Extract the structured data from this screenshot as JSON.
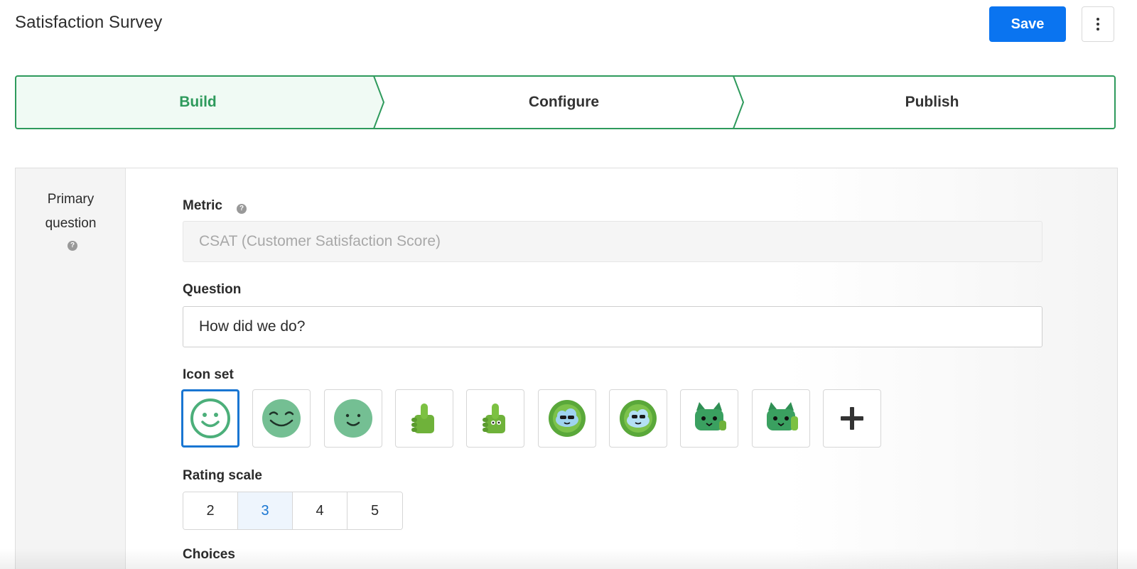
{
  "header": {
    "title": "Satisfaction Survey",
    "save_label": "Save",
    "more_icon": "more-vertical-icon"
  },
  "steps": [
    {
      "label": "Build",
      "active": true
    },
    {
      "label": "Configure",
      "active": false
    },
    {
      "label": "Publish",
      "active": false
    }
  ],
  "sidebar": {
    "title_line1": "Primary",
    "title_line2": "question",
    "help_icon": "help-circle-icon"
  },
  "form": {
    "metric": {
      "label": "Metric",
      "value": "CSAT (Customer Satisfaction Score)",
      "disabled": true
    },
    "question": {
      "label": "Question",
      "value": "How did we do?"
    },
    "icon_set": {
      "label": "Icon set",
      "selected_index": 0,
      "options": [
        "smiley-outline-icon",
        "smiley-grin-filled-icon",
        "smiley-filled-icon",
        "thumbs-up-icon",
        "thumbs-up-face-icon",
        "cool-cloud-icon",
        "cool-cloud-alt-icon",
        "cat-icon",
        "cat-thumbs-up-icon",
        "add-icon"
      ]
    },
    "rating_scale": {
      "label": "Rating scale",
      "options": [
        "2",
        "3",
        "4",
        "5"
      ],
      "selected": "3"
    },
    "choices": {
      "label": "Choices"
    }
  },
  "colors": {
    "primary_blue": "#0a74f0",
    "step_green": "#2e9a5c",
    "active_step_bg": "#f0faf4",
    "selected_border": "#1976d2"
  }
}
